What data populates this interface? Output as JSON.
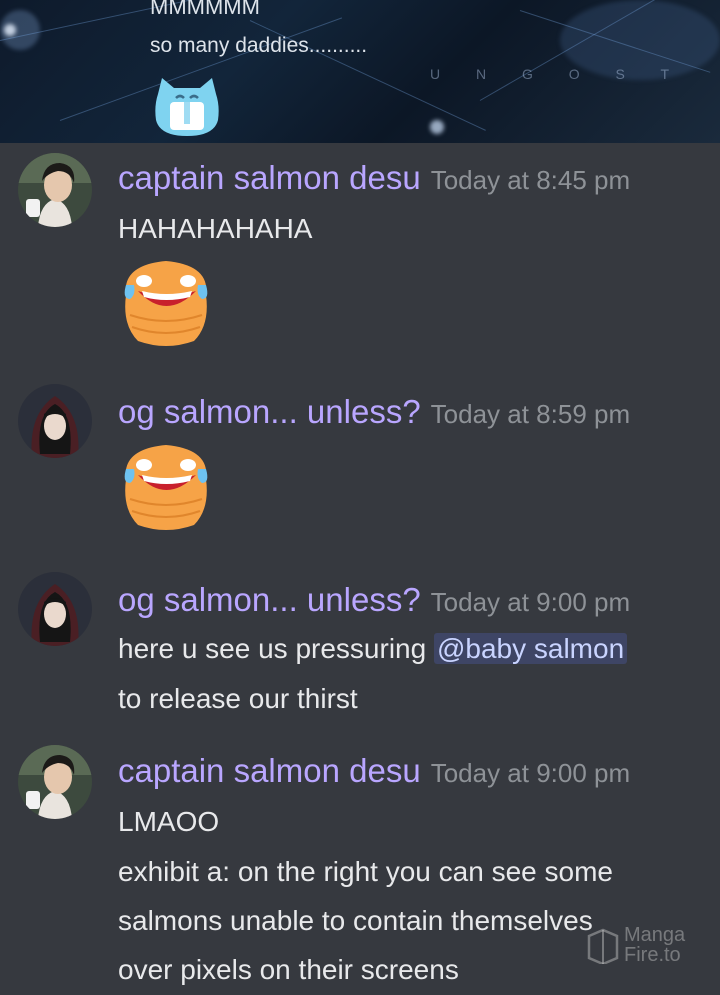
{
  "banner": {
    "line1": "MMMMMM",
    "line2": "so many daddies..........",
    "watermark": "U N G O S T"
  },
  "messages": [
    {
      "author": "captain salmon desu",
      "timestamp": "Today at 8:45 pm",
      "lines": [
        "HAHAHAHAHA"
      ]
    },
    {
      "author": "og salmon... unless?",
      "timestamp": "Today at 8:59 pm",
      "lines": []
    },
    {
      "author": "og salmon... unless?",
      "timestamp": "Today at 9:00 pm",
      "line1_prefix": "here u see us pressuring ",
      "mention": "@baby salmon",
      "line2": "to release our thirst"
    },
    {
      "author": "captain salmon desu",
      "timestamp": "Today at 9:00 pm",
      "lines": [
        "LMAOO",
        "exhibit a: on the right you can see some",
        "salmons unable to contain themselves",
        "over pixels on their screens"
      ]
    }
  ],
  "watermark": {
    "line1": "Manga",
    "line2": "Fire.to"
  },
  "colors": {
    "background": "#36393f",
    "author": "#b9a6ff",
    "timestamp": "#8e9297",
    "text": "#e8e9eb",
    "mention_bg": "#3e4565"
  }
}
